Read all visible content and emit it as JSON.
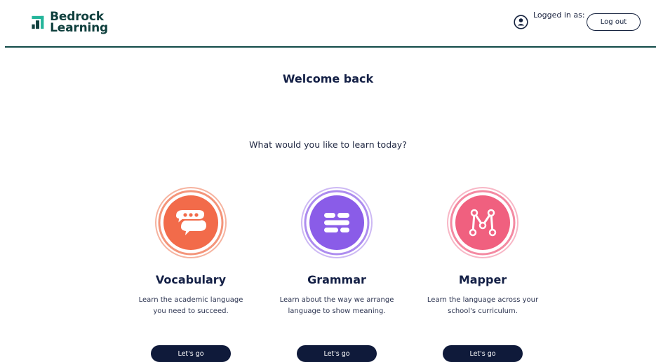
{
  "header": {
    "brand_line1": "Bedrock",
    "brand_line2": "Learning",
    "logged_in_label": "Logged in as:",
    "logout_label": "Log out"
  },
  "main": {
    "title": "Welcome back",
    "subtitle": "What would you like to learn today?"
  },
  "cards": [
    {
      "title": "Vocabulary",
      "desc_line1": "Learn the academic language",
      "desc_line2": "you need to succeed.",
      "button_label": "Let's go",
      "icon": "speech-bubbles-icon",
      "color": "#f26b4a"
    },
    {
      "title": "Grammar",
      "desc_line1": "Learn about the way we arrange",
      "desc_line2": "language to show meaning.",
      "button_label": "Let's go",
      "icon": "sentence-blocks-icon",
      "color": "#8a5ce8"
    },
    {
      "title": "Mapper",
      "desc_line1": "Learn the language across your",
      "desc_line2": "school's curriculum.",
      "button_label": "Let's go",
      "icon": "network-map-icon",
      "color": "#f0607f"
    }
  ],
  "colors": {
    "brand": "#0f3f3d",
    "navy": "#0f1a3a",
    "header_rule": "#114a48"
  }
}
